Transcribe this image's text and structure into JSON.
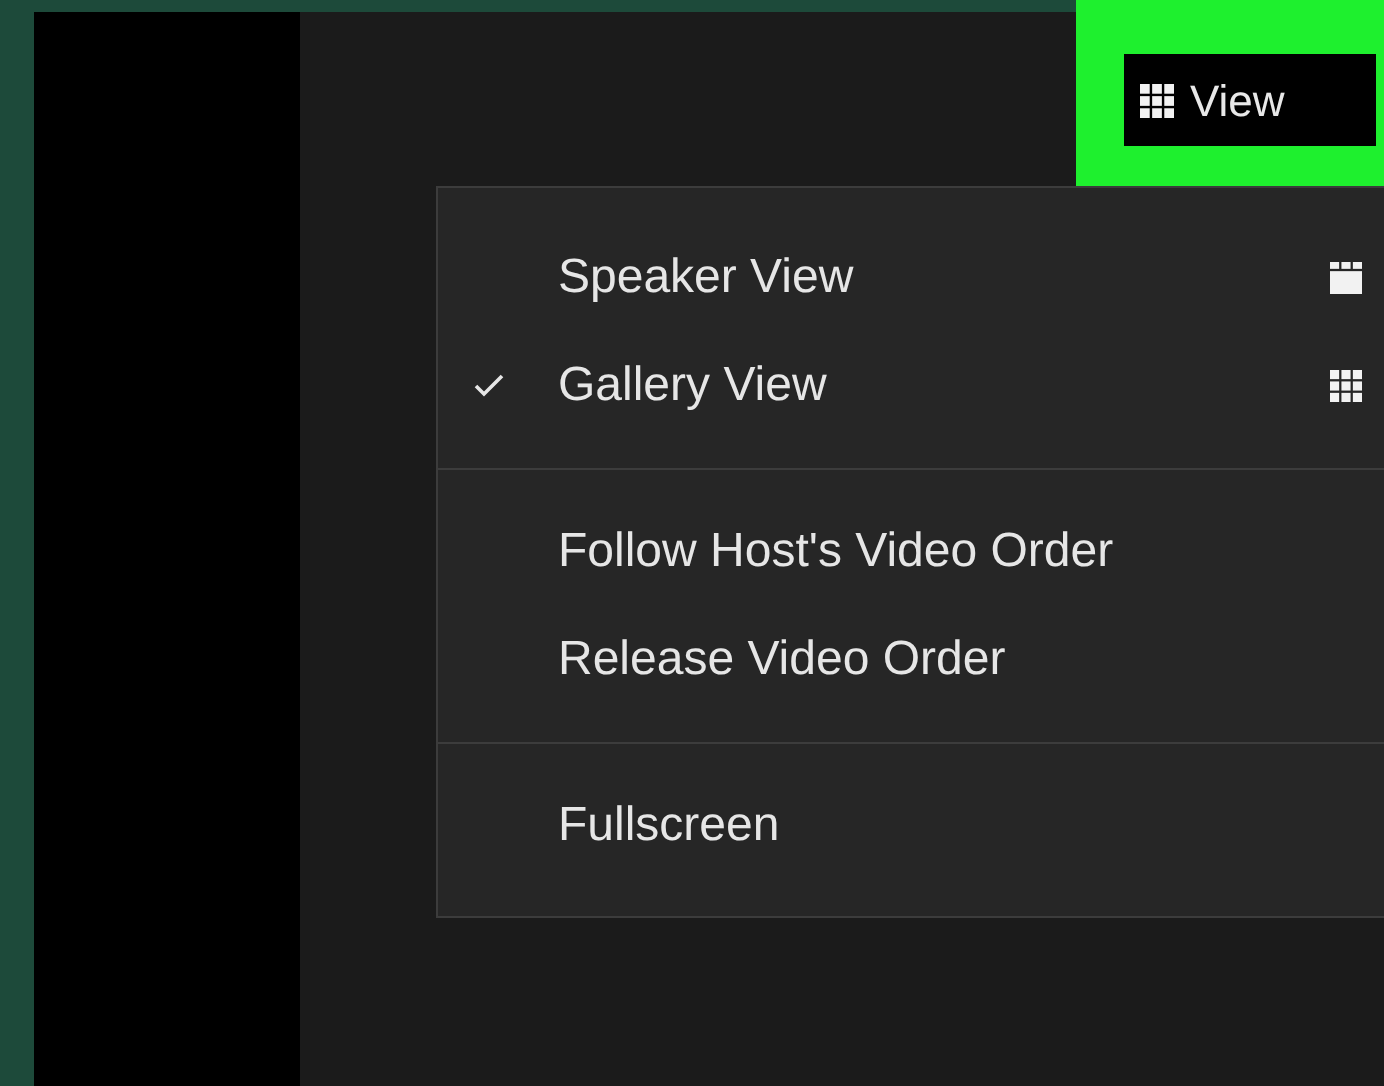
{
  "toolbar": {
    "view_button": {
      "label": "View",
      "highlighted": true
    }
  },
  "view_menu": {
    "items": [
      {
        "kind": "speaker",
        "label": "Speaker View",
        "checked": false
      },
      {
        "kind": "gallery",
        "label": "Gallery View",
        "checked": true
      },
      {
        "kind": "divider"
      },
      {
        "kind": "item",
        "label": "Follow Host's Video Order",
        "checked": false
      },
      {
        "kind": "item",
        "label": "Release Video Order",
        "checked": false
      },
      {
        "kind": "divider"
      },
      {
        "kind": "item",
        "label": "Fullscreen",
        "checked": false
      }
    ]
  }
}
